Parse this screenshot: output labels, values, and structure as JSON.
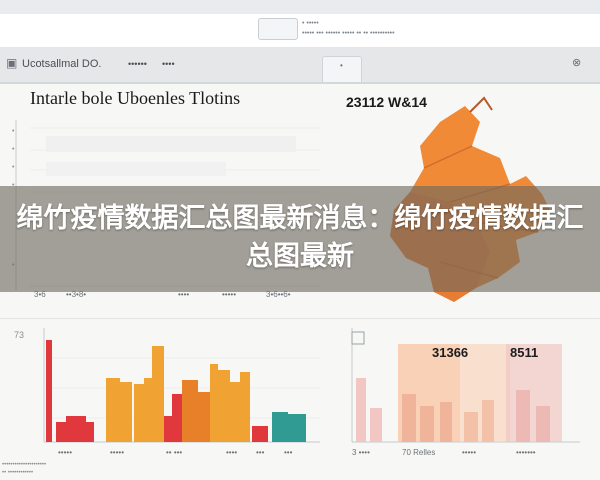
{
  "window": {
    "app_label": "Ucotsallmal DO.",
    "tab_meta": [
      "• •••••",
      "••••• ••• ••••••  ••••• ••  ••  ••••••••••"
    ]
  },
  "toolbar": {
    "items": [
      "••••••",
      "••••",
      "•"
    ]
  },
  "left_panel": {
    "title": "Intarle bole Uboenles Tlotins",
    "axis_ticks": [
      "•",
      "•",
      "•",
      "•",
      "•"
    ],
    "bottom_labels": [
      "3•6",
      "••3•8•",
      "••••",
      "•••••",
      "3•6••6•"
    ]
  },
  "map_panel": {
    "title": "23112 W&14"
  },
  "lower_left": {
    "axis_label": "73",
    "x_labels": [
      "•••••",
      "•••••",
      "•• •••",
      "••••",
      "•••",
      "•••"
    ]
  },
  "lower_right": {
    "value_a": "31366",
    "value_b": "8511",
    "x_labels": [
      "3 ••••",
      "70 Relles",
      "•••••",
      "•••••••"
    ]
  },
  "headline": {
    "text": "绵竹疫情数据汇总图最新消息：绵竹疫情数据汇总图最新"
  },
  "footer": {
    "lines": [
      "•••••••••••••••••••••",
      "•• ••••••••••••"
    ]
  },
  "colors": {
    "red": "#e0383c",
    "orange": "#f0a232",
    "orange_dark": "#e8802a",
    "teal": "#2f9b92",
    "peach": "#f7c7a7",
    "pink": "#f1c6c3",
    "map_orange": "#f08a37"
  }
}
